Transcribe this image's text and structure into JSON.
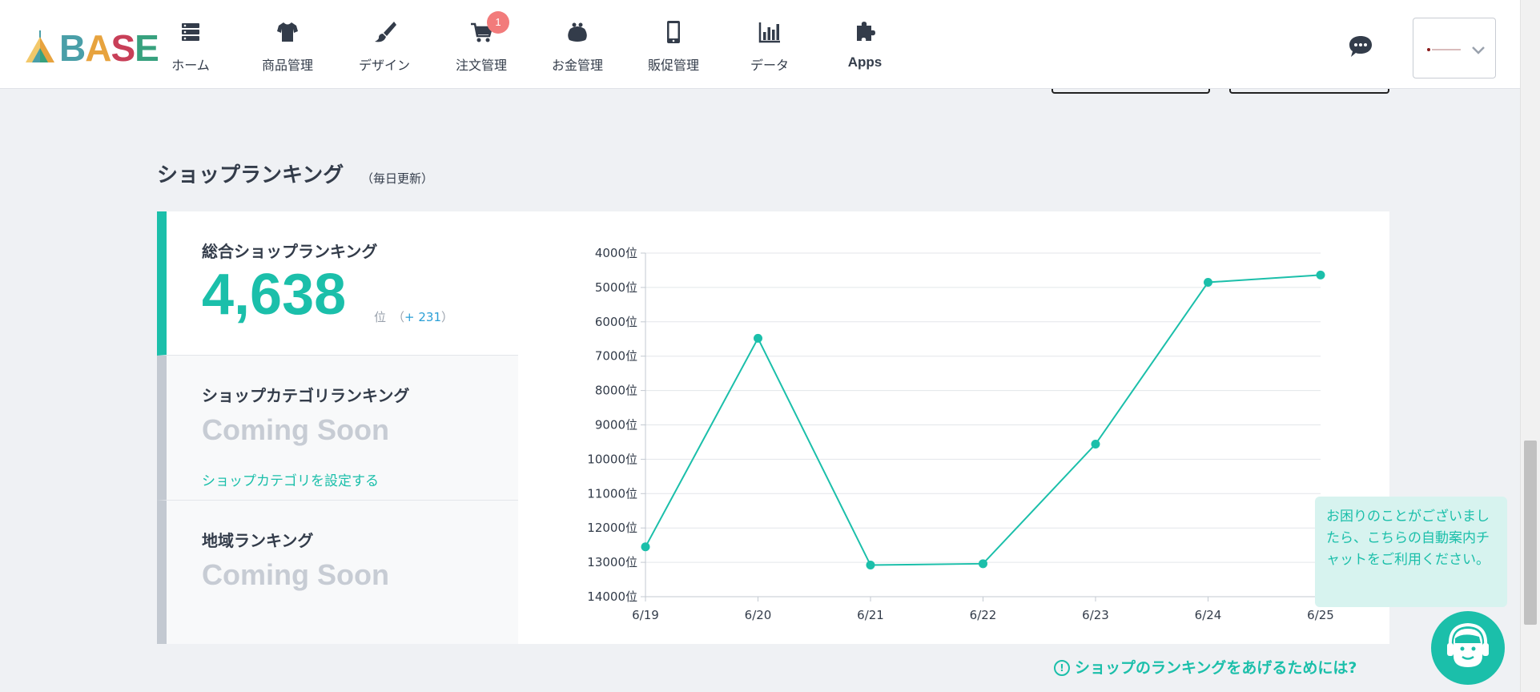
{
  "brand": {
    "logo_text": [
      "B",
      "A",
      "S",
      "E"
    ],
    "colors": {
      "accent": "#1bbfaa",
      "badge": "#f27b7b",
      "link_blue": "#2a9fd6"
    }
  },
  "nav": [
    {
      "id": "home",
      "label": "ホーム",
      "icon": "server-icon"
    },
    {
      "id": "products",
      "label": "商品管理",
      "icon": "tshirt-icon"
    },
    {
      "id": "design",
      "label": "デザイン",
      "icon": "paintbrush-icon"
    },
    {
      "id": "orders",
      "label": "注文管理",
      "icon": "cart-icon",
      "badge": "1"
    },
    {
      "id": "money",
      "label": "お金管理",
      "icon": "purse-icon"
    },
    {
      "id": "promotion",
      "label": "販促管理",
      "icon": "smartphone-icon"
    },
    {
      "id": "data",
      "label": "データ",
      "icon": "bar-chart-icon"
    },
    {
      "id": "apps",
      "label": "Apps",
      "icon": "puzzle-icon"
    }
  ],
  "section": {
    "title": "ショップランキング",
    "subtitle": "（毎日更新）"
  },
  "tabs": {
    "overall": {
      "title": "総合ショップランキング",
      "rank": "4,638",
      "unit": "位",
      "delta_open": "（",
      "delta_value": "+ 231",
      "delta_close": "）"
    },
    "category": {
      "title": "ショップカテゴリランキング",
      "status": "Coming Soon",
      "link": "ショップカテゴリを設定する"
    },
    "region": {
      "title": "地域ランキング",
      "status": "Coming Soon"
    }
  },
  "chart_data": {
    "type": "line",
    "x": [
      "6/19",
      "6/20",
      "6/21",
      "6/22",
      "6/23",
      "6/24",
      "6/25"
    ],
    "series": [
      {
        "values": [
          12550,
          6480,
          13080,
          13040,
          9560,
          4850,
          4638
        ]
      }
    ],
    "ylim": [
      4000,
      14000
    ],
    "y_ticks": [
      4000,
      5000,
      6000,
      7000,
      8000,
      9000,
      10000,
      11000,
      12000,
      13000,
      14000
    ],
    "y_tick_suffix": "位",
    "y_inverted": true,
    "grid": true,
    "color": "#1bbfaa"
  },
  "tips_link": {
    "icon": "!",
    "text": "ショップのランキングをあげるためには?"
  },
  "help": {
    "bubble": "お困りのことがございましたら、こちらの自動案内チャットをご利用ください。"
  }
}
